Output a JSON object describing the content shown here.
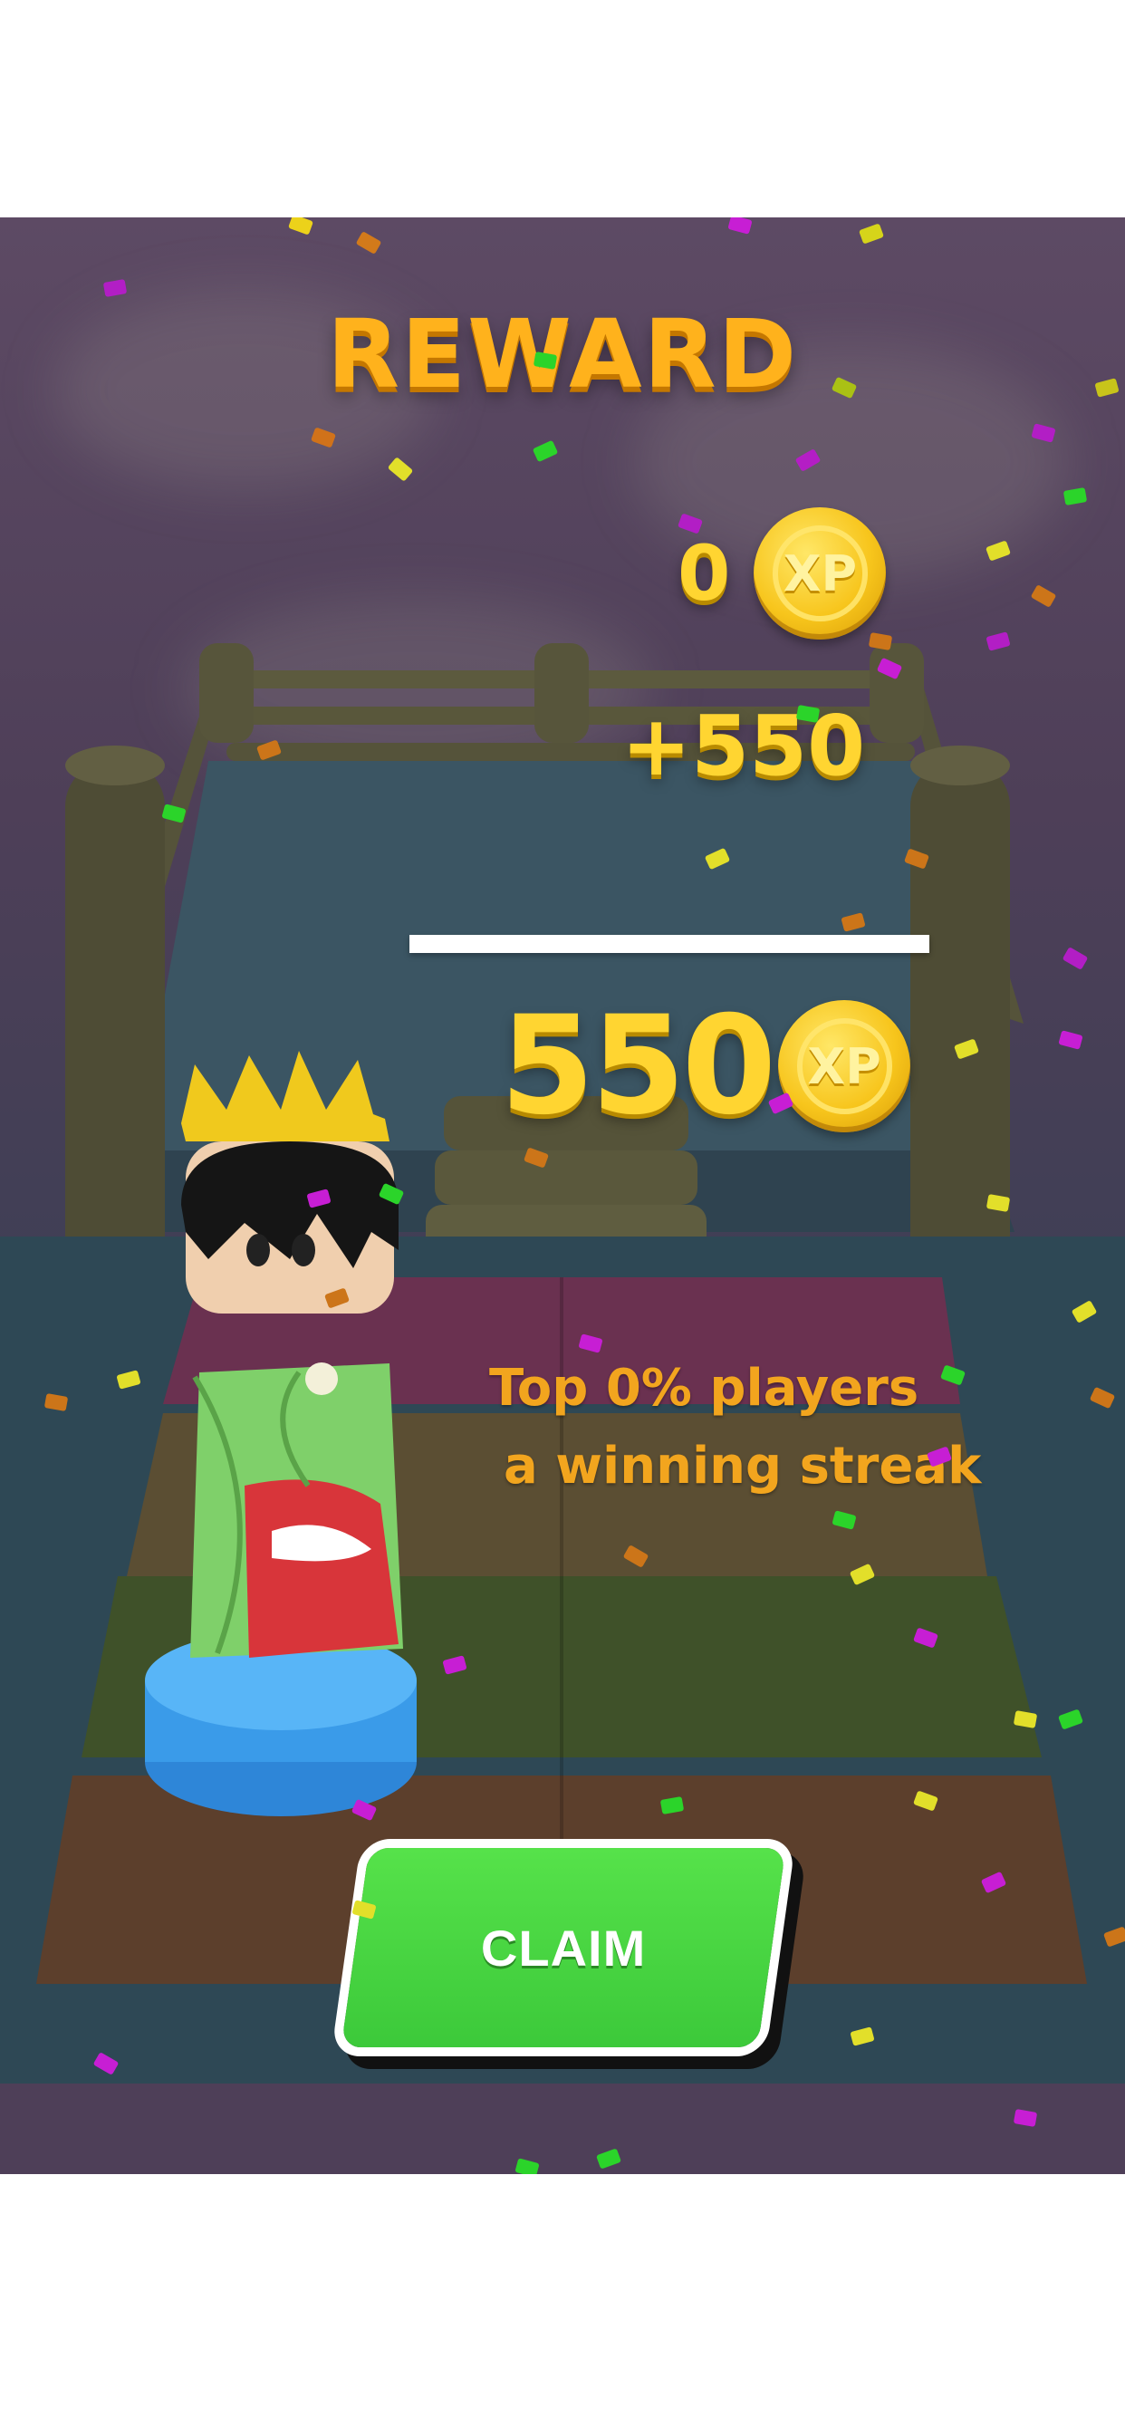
{
  "title": "REWARD",
  "xp": {
    "current": "0",
    "gain": "+550",
    "total": "550",
    "coin_label": "XP",
    "coin_icon": "xp-coin-icon"
  },
  "message": {
    "line1": "Top 0% players",
    "line2": "a winning streak"
  },
  "claim_label": "CLAIM",
  "colors": {
    "title": "#ffb21c",
    "xp_text": "#ffd531",
    "caption": "#f2a51e",
    "claim_button": "#44d13f",
    "scene_top": "#5d4a64",
    "scene_bottom": "#2f4450"
  }
}
